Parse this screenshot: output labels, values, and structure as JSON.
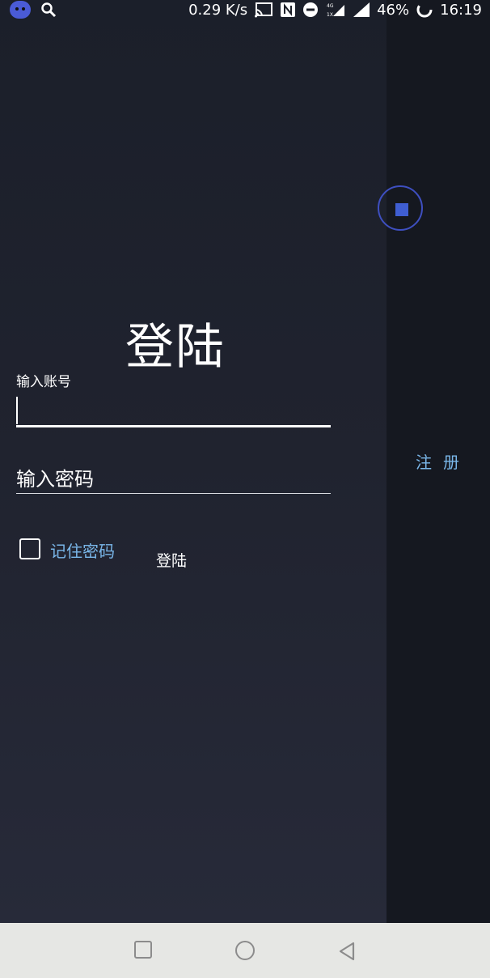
{
  "status_bar": {
    "speed": "0.29 K/s",
    "battery": "46%",
    "time": "16:19",
    "icons": [
      "app-badge-icon",
      "search-icon",
      "cast-icon",
      "nfc-icon",
      "dnd-icon",
      "4g-signal-icon",
      "signal-icon",
      "battery-icon"
    ]
  },
  "login": {
    "title": "登陆",
    "account_label": "输入账号",
    "password_placeholder": "输入密码",
    "remember_label": "记住密码",
    "login_button": "登陆",
    "register_link": "注册"
  },
  "colors": {
    "background": "#1c1f28",
    "side_panel": "#151820",
    "accent": "#7ab7ea",
    "fab_accent": "#3f5ed2",
    "navbar": "#e6e7e4"
  },
  "nav": {
    "icons": [
      "recents-icon",
      "home-icon",
      "back-icon"
    ]
  }
}
